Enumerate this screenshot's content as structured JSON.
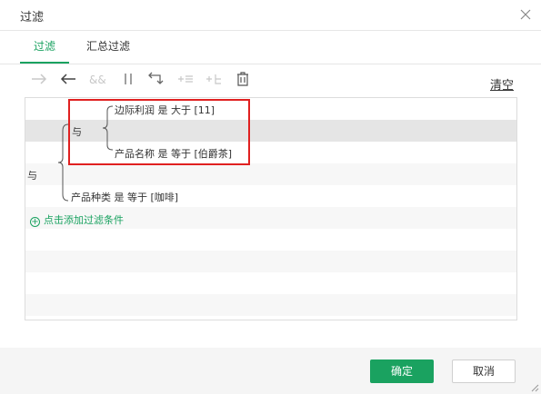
{
  "dialog": {
    "title": "过滤",
    "close_icon": "close-icon"
  },
  "tabs": [
    {
      "label": "过滤",
      "active": true
    },
    {
      "label": "汇总过滤",
      "active": false
    }
  ],
  "toolbar": {
    "icons": [
      "indent-right-icon",
      "indent-left-icon",
      "and-icon",
      "or-icon",
      "swap-icon",
      "add-condition-icon",
      "add-sub-condition-icon",
      "delete-icon"
    ],
    "clear_label": "清空"
  },
  "filter_tree": {
    "outer_logic": "与",
    "inner_logic": "与",
    "conditions": [
      {
        "text": "边际利润 是 大于 [11]"
      },
      {
        "text": "产品名称 是 等于 [伯爵茶]"
      },
      {
        "text": "产品种类 是 等于 [咖啡]"
      }
    ],
    "add_label": "点击添加过滤条件"
  },
  "footer": {
    "ok_label": "确定",
    "cancel_label": "取消"
  },
  "colors": {
    "accent": "#1aa260",
    "highlight": "#e02020"
  }
}
